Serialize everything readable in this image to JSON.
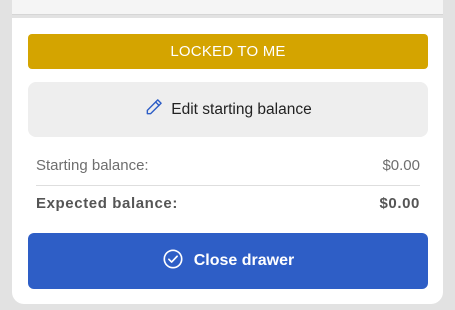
{
  "banner": {
    "label": "LOCKED TO ME",
    "color": "#d4a400"
  },
  "edit_button": {
    "label": "Edit starting balance",
    "icon": "pencil-icon"
  },
  "summary": {
    "starting_label": "Starting balance:",
    "starting_value": "$0.00",
    "expected_label": "Expected balance:",
    "expected_value": "$0.00"
  },
  "close_button": {
    "label": "Close drawer",
    "icon": "check-circle-icon",
    "color": "#2e5ec6"
  }
}
